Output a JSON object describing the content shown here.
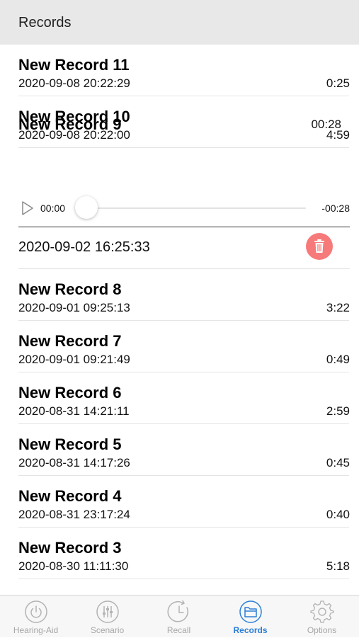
{
  "header": {
    "title": "Records"
  },
  "records_top": [
    {
      "name": "New Record 11",
      "date": "2020-09-08 20:22:29",
      "duration": "0:25"
    },
    {
      "name": "New Record 10",
      "date": "2020-09-08 20:22:00",
      "duration": "4:59"
    }
  ],
  "expanded": {
    "name": "New Record 9",
    "duration": "00:28",
    "player": {
      "current": "00:00",
      "remaining": "-00:28",
      "progress": 0
    },
    "date": "2020-09-02 16:25:33",
    "delete_icon": "trash-icon"
  },
  "records_bottom": [
    {
      "name": "New Record 8",
      "date": "2020-09-01 09:25:13",
      "duration": "3:22"
    },
    {
      "name": "New Record 7",
      "date": "2020-09-01 09:21:49",
      "duration": "0:49"
    },
    {
      "name": "New Record 6",
      "date": "2020-08-31 14:21:11",
      "duration": "2:59"
    },
    {
      "name": "New Record 5",
      "date": "2020-08-31 14:17:26",
      "duration": "0:45"
    },
    {
      "name": "New Record 4",
      "date": "2020-08-31 23:17:24",
      "duration": "0:40"
    },
    {
      "name": "New Record 3",
      "date": "2020-08-30 11:11:30",
      "duration": "5:18"
    }
  ],
  "tabs": [
    {
      "label": "Hearing-Aid",
      "icon": "power-icon",
      "active": false
    },
    {
      "label": "Scenario",
      "icon": "sliders-icon",
      "active": false
    },
    {
      "label": "Recall",
      "icon": "clock-icon",
      "active": false
    },
    {
      "label": "Records",
      "icon": "folder-icon",
      "active": true
    },
    {
      "label": "Options",
      "icon": "gear-icon",
      "active": false
    }
  ],
  "colors": {
    "accent": "#2c7fd6",
    "delete": "#f77a7a",
    "tab_inactive": "#a6a6a6"
  }
}
